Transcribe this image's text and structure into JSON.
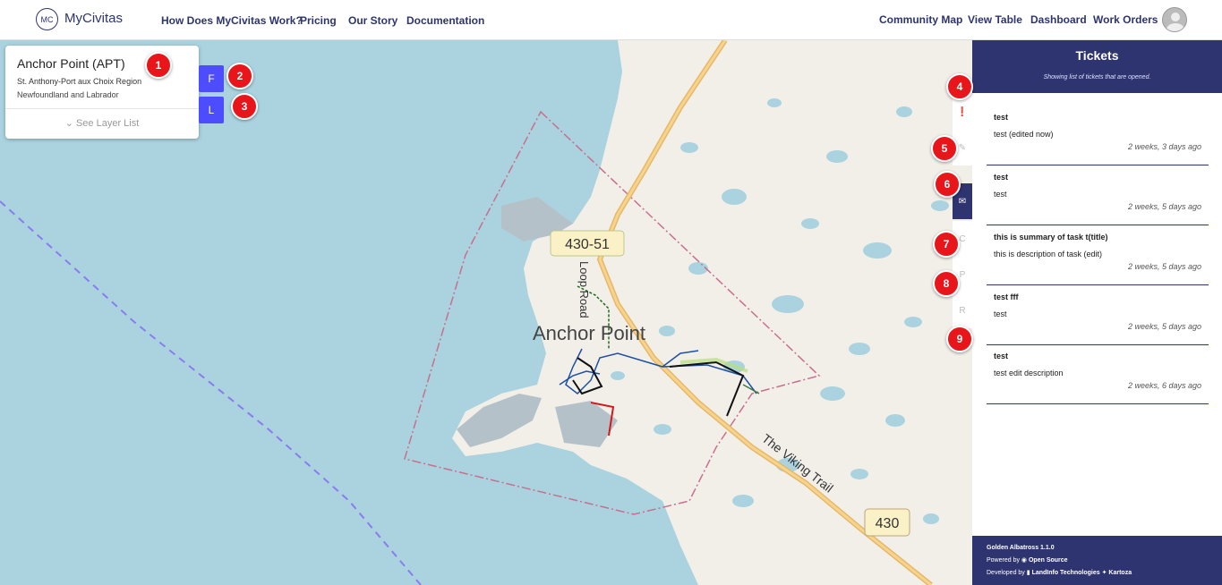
{
  "nav": {
    "logo": "MC",
    "brand": "MyCivitas",
    "links_left": [
      "How Does MyCivitas Work?",
      "Pricing",
      "Our Story",
      "Documentation"
    ],
    "links_right": [
      "Community Map",
      "View Table",
      "Dashboard",
      "Work Orders"
    ]
  },
  "info": {
    "title": "Anchor Point (APT)",
    "region": "St. Anthony-Port aux Choix Region",
    "province": "Newfoundland and Labrador",
    "layer_toggle": "See Layer List"
  },
  "buttons": {
    "f": "F",
    "l": "L"
  },
  "markers": [
    "1",
    "2",
    "3",
    "4",
    "5",
    "6",
    "7",
    "8",
    "9"
  ],
  "side_tabs": {
    "c": "C",
    "p": "P",
    "r": "R"
  },
  "map_labels": {
    "road_430_51": "430-51",
    "loop_road": "Loop Road",
    "town": "Anchor Point",
    "viking_trail": "The Viking Trail",
    "road_430": "430"
  },
  "panel": {
    "title": "Tickets",
    "subtitle": "Showing list of tickets that are opened.",
    "tickets": [
      {
        "title": "test",
        "desc": "test (edited now)",
        "time": "2 weeks, 3 days ago"
      },
      {
        "title": "test",
        "desc": "test",
        "time": "2 weeks, 5 days ago"
      },
      {
        "title": "this is summary of task t(title)",
        "desc": "this is description of task (edit)",
        "time": "2 weeks, 5 days ago"
      },
      {
        "title": "test fff",
        "desc": "test",
        "time": "2 weeks, 5 days ago"
      },
      {
        "title": "test",
        "desc": "test edit description",
        "time": "2 weeks, 6 days ago"
      }
    ]
  },
  "footer": {
    "version": "Golden Albatross 1.1.0",
    "powered_label": "Powered by",
    "powered_value": "Open Source",
    "developed_label": "Developed by",
    "developer_1": "LandInfo Technologies",
    "developer_2": "Kartoza"
  },
  "colors": {
    "brand": "#2d3470",
    "button": "#4e4cff",
    "marker": "#e8161a",
    "water": "#aad3df",
    "land": "#f2efe9"
  }
}
